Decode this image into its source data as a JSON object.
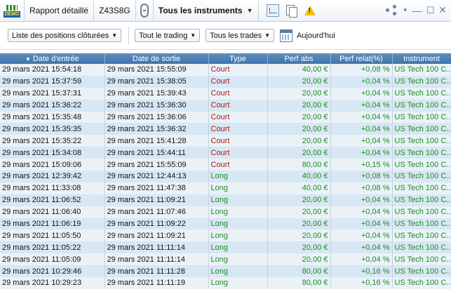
{
  "titlebar": {
    "demo_badge": "DEMO",
    "report": "Rapport détaillé",
    "account": "Z43S8G",
    "instrument_filter": "Tous les instruments",
    "icons": [
      "demo-icon",
      "link-icon",
      "chevron-down-icon",
      "chart-icon",
      "copy-icon",
      "warning-icon",
      "share-icon",
      "minimize-icon",
      "maximize-icon",
      "close-icon"
    ]
  },
  "toolbar": {
    "positions_filter": "Liste des positions clôturées",
    "trading_filter": "Tout le trading",
    "trades_filter": "Tous les trades",
    "date_label": "Aujourd'hui"
  },
  "table": {
    "columns": [
      "Date d'entrée",
      "Date de sortie",
      "Type",
      "Perf abs",
      "Perf relat(%)",
      "Instrument"
    ],
    "rows": [
      [
        "29 mars 2021 15:54:18",
        "29 mars 2021 15:55:09",
        "Court",
        "40,00 €",
        "+0,08 %",
        "US Tech 100 C..."
      ],
      [
        "29 mars 2021 15:37:59",
        "29 mars 2021 15:38:05",
        "Court",
        "20,00 €",
        "+0,04 %",
        "US Tech 100 C..."
      ],
      [
        "29 mars 2021 15:37:31",
        "29 mars 2021 15:39:43",
        "Court",
        "20,00 €",
        "+0,04 %",
        "US Tech 100 C..."
      ],
      [
        "29 mars 2021 15:36:22",
        "29 mars 2021 15:36:30",
        "Court",
        "20,00 €",
        "+0,04 %",
        "US Tech 100 C..."
      ],
      [
        "29 mars 2021 15:35:48",
        "29 mars 2021 15:36:06",
        "Court",
        "20,00 €",
        "+0,04 %",
        "US Tech 100 C..."
      ],
      [
        "29 mars 2021 15:35:35",
        "29 mars 2021 15:36:32",
        "Court",
        "20,00 €",
        "+0,04 %",
        "US Tech 100 C..."
      ],
      [
        "29 mars 2021 15:35:22",
        "29 mars 2021 15:41:28",
        "Court",
        "20,00 €",
        "+0,04 %",
        "US Tech 100 C..."
      ],
      [
        "29 mars 2021 15:34:08",
        "29 mars 2021 15:44:11",
        "Court",
        "20,00 €",
        "+0,04 %",
        "US Tech 100 C..."
      ],
      [
        "29 mars 2021 15:09:06",
        "29 mars 2021 15:55:09",
        "Court",
        "80,00 €",
        "+0,15 %",
        "US Tech 100 C..."
      ],
      [
        "29 mars 2021 12:39:42",
        "29 mars 2021 12:44:13",
        "Long",
        "40,00 €",
        "+0,08 %",
        "US Tech 100 C..."
      ],
      [
        "29 mars 2021 11:33:08",
        "29 mars 2021 11:47:38",
        "Long",
        "40,00 €",
        "+0,08 %",
        "US Tech 100 C..."
      ],
      [
        "29 mars 2021 11:06:52",
        "29 mars 2021 11:09:21",
        "Long",
        "20,00 €",
        "+0,04 %",
        "US Tech 100 C..."
      ],
      [
        "29 mars 2021 11:06:40",
        "29 mars 2021 11:07:46",
        "Long",
        "20,00 €",
        "+0,04 %",
        "US Tech 100 C..."
      ],
      [
        "29 mars 2021 11:06:19",
        "29 mars 2021 11:09:22",
        "Long",
        "20,00 €",
        "+0,04 %",
        "US Tech 100 C..."
      ],
      [
        "29 mars 2021 11:05:50",
        "29 mars 2021 11:09:21",
        "Long",
        "20,00 €",
        "+0,04 %",
        "US Tech 100 C..."
      ],
      [
        "29 mars 2021 11:05:22",
        "29 mars 2021 11:11:14",
        "Long",
        "20,00 €",
        "+0,04 %",
        "US Tech 100 C..."
      ],
      [
        "29 mars 2021 11:05:09",
        "29 mars 2021 11:11:14",
        "Long",
        "20,00 €",
        "+0,04 %",
        "US Tech 100 C..."
      ],
      [
        "29 mars 2021 10:29:46",
        "29 mars 2021 11:11:28",
        "Long",
        "80,00 €",
        "+0,16 %",
        "US Tech 100 C..."
      ],
      [
        "29 mars 2021 10:29:23",
        "29 mars 2021 11:11:19",
        "Long",
        "80,00 €",
        "+0,16 %",
        "US Tech 100 C..."
      ]
    ]
  },
  "colors": {
    "header_bg": "#4a7fb5",
    "row_even": "#eaf2f8",
    "row_odd": "#d7e7f3",
    "court": "#b31515",
    "long": "#1f8a1f"
  }
}
